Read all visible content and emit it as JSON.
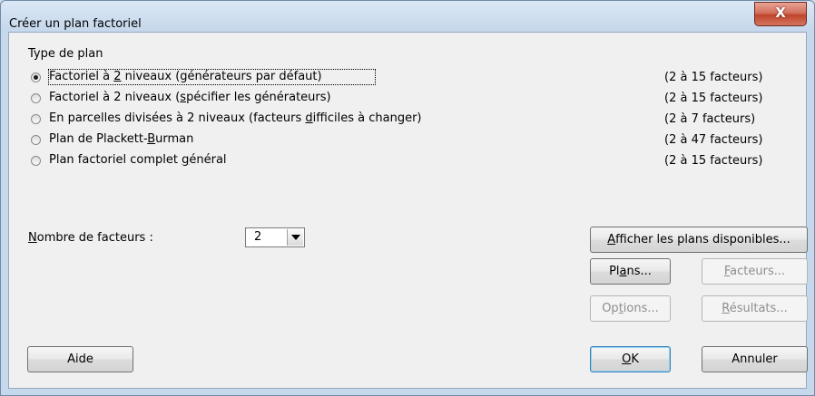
{
  "window": {
    "title": "Créer un plan factoriel",
    "close_label": "X"
  },
  "group": {
    "label": "Type de plan"
  },
  "options": [
    {
      "pre": "Factoriel à ",
      "key": "2",
      "post": " niveaux (générateurs par défaut)",
      "range": "(2 à 15 facteurs)",
      "selected": true
    },
    {
      "pre": "Factoriel à 2 niveaux (",
      "key": "s",
      "post": "pécifier les générateurs)",
      "range": "(2 à 15 facteurs)",
      "selected": false
    },
    {
      "pre": "En parcelles divisées à 2 niveaux (facteurs ",
      "key": "d",
      "post": "ifficiles à changer)",
      "range": "(2 à 7 facteurs)",
      "selected": false
    },
    {
      "pre": "Plan de Plackett-",
      "key": "B",
      "post": "urman",
      "range": "(2 à 47 facteurs)",
      "selected": false
    },
    {
      "pre": "Plan factoriel complet ",
      "key": "g",
      "post": "énéral",
      "range": "(2 à 15 facteurs)",
      "selected": false
    }
  ],
  "factors": {
    "label_key": "N",
    "label_rest": "ombre de facteurs :",
    "value": "2"
  },
  "buttons": {
    "show_plans": {
      "key": "A",
      "rest": "fficher les plans disponibles..."
    },
    "plans": {
      "pre": "Pl",
      "key": "a",
      "post": "ns..."
    },
    "factors": {
      "key": "F",
      "rest": "acteurs..."
    },
    "options": {
      "pre": "Op",
      "key": "t",
      "post": "ions..."
    },
    "results": {
      "key": "R",
      "rest": "ésultats..."
    },
    "help": "Aide",
    "ok": {
      "key": "O",
      "rest": "K"
    },
    "cancel": "Annuler"
  }
}
